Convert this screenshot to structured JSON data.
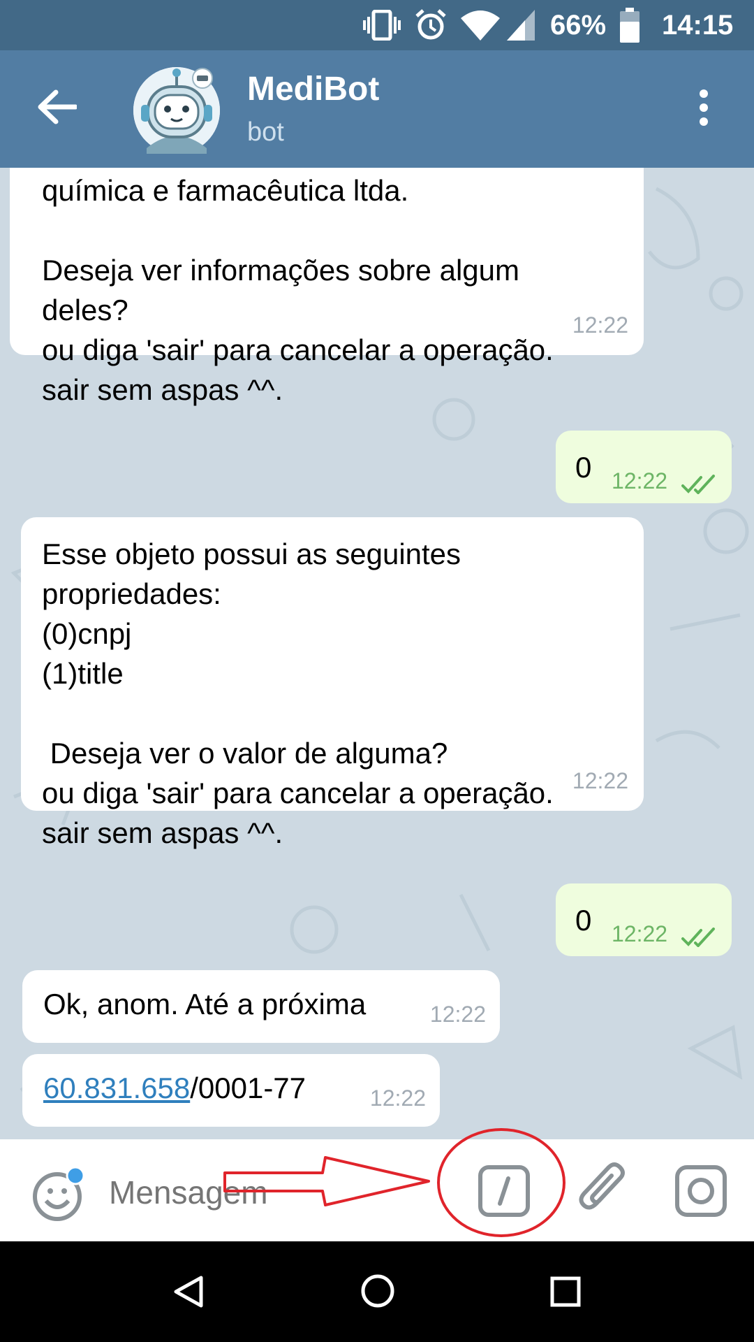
{
  "status_bar": {
    "battery": "66%",
    "time": "14:15",
    "icons": [
      "vibrate-icon",
      "alarm-icon",
      "wifi-icon",
      "signal-icon",
      "battery-icon"
    ]
  },
  "header": {
    "name": "MediBot",
    "subtitle": "bot",
    "icons": [
      "back-arrow-icon",
      "robot-avatar",
      "more-vertical-icon"
    ]
  },
  "messages": [
    {
      "side": "in",
      "lines": "química e farmacêutica ltda.\n\nDeseja ver informações sobre algum\ndeles?\nou diga 'sair' para cancelar a operação.\nsair sem aspas ^^.",
      "time": "12:22"
    },
    {
      "side": "out",
      "text": "0",
      "time": "12:22",
      "status": "double-check-icon"
    },
    {
      "side": "in",
      "lines": "Esse objeto possui as seguintes\npropriedades:\n(0)cnpj\n(1)title\n\n Deseja ver o valor de alguma?\nou diga 'sair' para cancelar a operação.\nsair sem aspas ^^.",
      "time": "12:22"
    },
    {
      "side": "out",
      "text": "0",
      "time": "12:22",
      "status": "double-check-icon"
    },
    {
      "side": "in",
      "text": "Ok, anom. Até a próxima",
      "time": "12:22"
    },
    {
      "side": "in",
      "link": "60.831.658",
      "text_after": "/0001-77",
      "time": "12:22"
    }
  ],
  "input_bar": {
    "placeholder": "Mensagem",
    "icons": [
      "emoji-icon",
      "bot-command-icon",
      "attach-icon",
      "camera-icon"
    ]
  },
  "annotation": {
    "color": "#e0242b",
    "shapes": [
      "arrow",
      "circle"
    ]
  },
  "nav_bar": {
    "icons": [
      "back-icon",
      "home-icon",
      "recents-icon"
    ]
  },
  "colors": {
    "header": "#527da3",
    "status_bar": "#426987",
    "incoming": "#ffffff",
    "outgoing": "#effdde",
    "link": "#2f7fbd",
    "check": "#5fb35b"
  }
}
